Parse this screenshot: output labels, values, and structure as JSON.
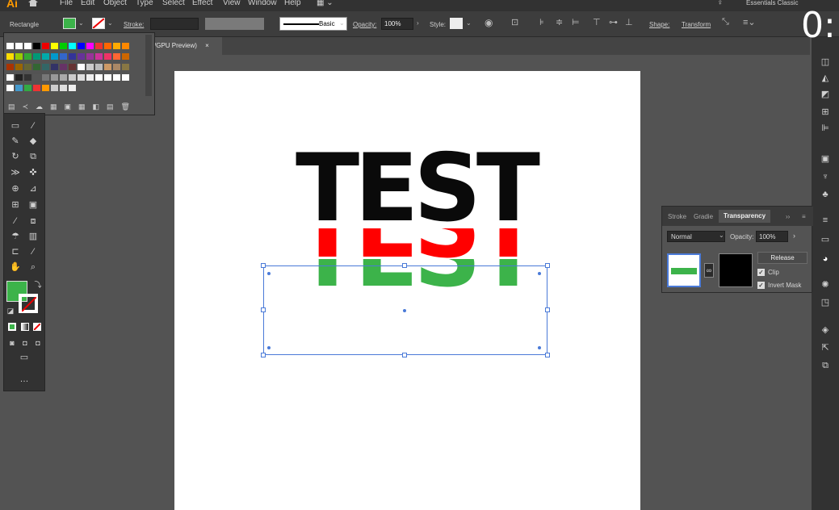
{
  "menubar": {
    "logo": "Ai",
    "items": [
      "File",
      "Edit",
      "Object",
      "Type",
      "Select",
      "Effect",
      "View",
      "Window",
      "Help"
    ],
    "workspace": "Essentials Classic"
  },
  "control": {
    "object_type": "Rectangle",
    "stroke_label": "Stroke:",
    "stroke_style": "Basic",
    "opacity_label": "Opacity:",
    "opacity_value": "100%",
    "style_label": "Style:",
    "shape_label": "Shape:",
    "transform_label": "Transform"
  },
  "document_tab": {
    "title": "/GPU Preview)",
    "close": "×"
  },
  "artwork": {
    "text_black": "TEST",
    "text_red": "TEST",
    "text_green": "TEST",
    "colors": {
      "black": "#0a0a0a",
      "red": "#ff0000",
      "green": "#3cb34a"
    }
  },
  "transparency_panel": {
    "tabs": [
      "Stroke",
      "Gradie",
      "Transparency"
    ],
    "blend_mode": "Normal",
    "opacity_label": "Opacity:",
    "opacity_value": "100%",
    "release_button": "Release",
    "clip_label": "Clip",
    "invert_mask_label": "Invert Mask",
    "clip_checked": true,
    "invert_checked": true
  },
  "overlay": {
    "timer": "0:"
  },
  "fill_color": "#3cb34a",
  "accent_color": "#4a7ad8"
}
